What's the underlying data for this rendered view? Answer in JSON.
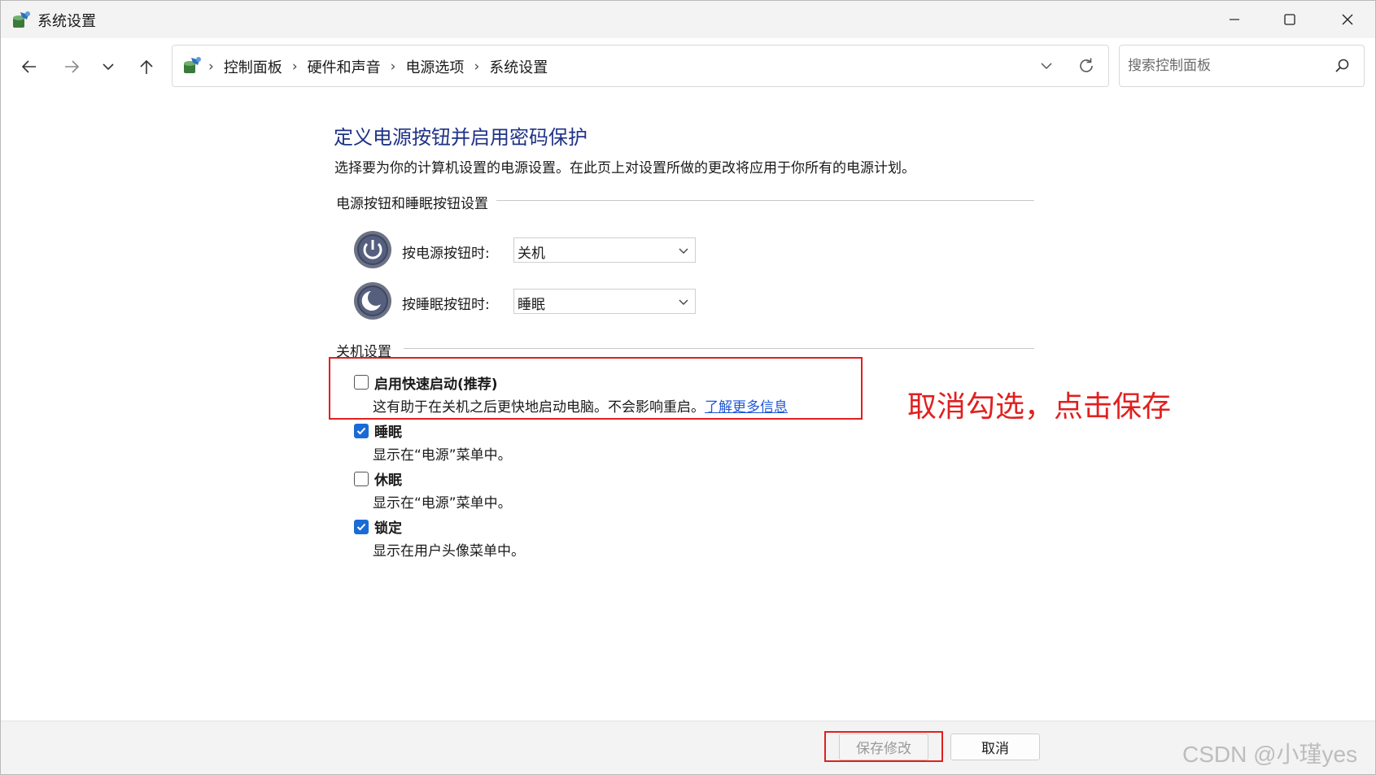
{
  "window": {
    "title": "系统设置",
    "icons": {
      "app": "control-panel-icon",
      "minimize": "minimize-icon",
      "maximize": "maximize-icon",
      "close": "close-icon"
    }
  },
  "nav": {
    "breadcrumbs": [
      "控制面板",
      "硬件和声音",
      "电源选项",
      "系统设置"
    ],
    "search_placeholder": "搜索控制面板",
    "icons": [
      "back-arrow-icon",
      "forward-arrow-icon",
      "chevron-down-icon",
      "up-arrow-icon",
      "refresh-icon",
      "search-icon"
    ]
  },
  "content": {
    "title": "定义电源按钮并启用密码保护",
    "description": "选择要为你的计算机设置的电源设置。在此页上对设置所做的更改将应用于你所有的电源计划。",
    "buttons_group": {
      "label": "电源按钮和睡眠按钮设置",
      "power_button": {
        "label": "按电源按钮时:",
        "value": "关机"
      },
      "sleep_button": {
        "label": "按睡眠按钮时:",
        "value": "睡眠"
      }
    },
    "shutdown_group": {
      "label": "关机设置",
      "fast_startup": {
        "title": "启用快速启动(推荐)",
        "desc": "这有助于在关机之后更快地启动电脑。不会影响重启。",
        "link": "了解更多信息",
        "checked": false
      },
      "sleep": {
        "title": "睡眠",
        "desc": "显示在“电源”菜单中。",
        "checked": true
      },
      "hibernate": {
        "title": "休眠",
        "desc": "显示在“电源”菜单中。",
        "checked": false
      },
      "lock": {
        "title": "锁定",
        "desc": "显示在用户头像菜单中。",
        "checked": true
      }
    }
  },
  "annotation": {
    "text": "取消勾选，点击保存",
    "color": "#e02020"
  },
  "footer": {
    "save_label": "保存修改",
    "cancel_label": "取消"
  },
  "watermark": "CSDN @小瑾yes",
  "colors": {
    "title_blue": "#1e3287",
    "checkbox_blue": "#1a6bd6",
    "link_blue": "#1f57d6",
    "highlight_red": "#e02020"
  }
}
